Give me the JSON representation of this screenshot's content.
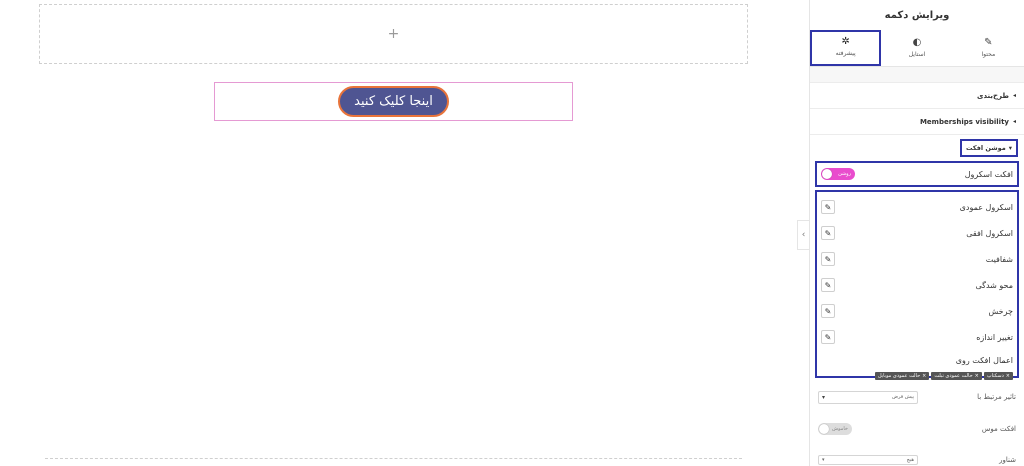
{
  "canvas": {
    "add_section_plus": "+",
    "button_label": "اینجا کلیک کنید"
  },
  "collapse_handle": "‹",
  "panel": {
    "title": "ویرایش دکمه",
    "tabs": [
      {
        "label": "محتوا",
        "icon": "pencil-icon",
        "glyph": "✎"
      },
      {
        "label": "استایل",
        "icon": "half-circle-icon",
        "glyph": "◐"
      },
      {
        "label": "پیشرفته",
        "icon": "gear-icon",
        "glyph": "✲"
      }
    ],
    "active_tab": "پیشرفته",
    "sections": {
      "layout": "طرح‌بندی",
      "memberships": "Memberships visibility",
      "motion": "موشن افکت"
    },
    "caret_collapsed": "◂",
    "caret_expanded": "▾",
    "scroll_effect": {
      "label": "افکت اسکرول",
      "toggle_text": "روشن",
      "enabled": true
    },
    "effects": [
      {
        "label": "اسکرول عمودی"
      },
      {
        "label": "اسکرول افقی"
      },
      {
        "label": "شفافیت"
      },
      {
        "label": "محو شدگی"
      },
      {
        "label": "چرخش"
      },
      {
        "label": "تغییر اندازه"
      }
    ],
    "edit_glyph": "✎",
    "apply_on": {
      "label": "اعمال افکت روی",
      "chips": [
        "دسکتاپ",
        "حالت عمودی تبلت",
        "حالت عمودی موبایل"
      ],
      "chip_x": "×"
    },
    "relative_to": {
      "label": "تاثیر مرتبط با",
      "value": "پیش فرض"
    },
    "mouse_effect": {
      "label": "افکت موس",
      "toggle_text": "خاموش",
      "enabled": false
    },
    "bottom_row": {
      "label": "شناور",
      "value": "هیچ"
    },
    "select_arrow": "▾"
  }
}
